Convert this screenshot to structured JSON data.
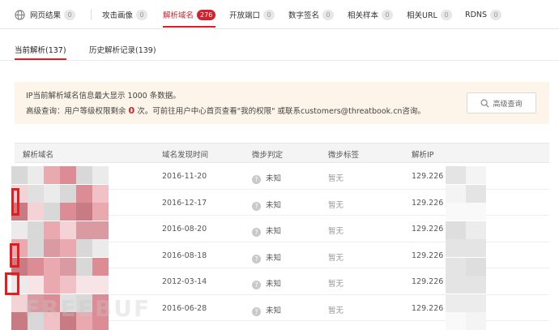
{
  "top_tabs": [
    {
      "label": "网页结果",
      "count": "0"
    },
    {
      "label": "攻击画像",
      "count": "0"
    },
    {
      "label": "解析域名",
      "count": "276"
    },
    {
      "label": "开放端口",
      "count": "0"
    },
    {
      "label": "数字签名",
      "count": "0"
    },
    {
      "label": "相关样本",
      "count": "0"
    },
    {
      "label": "相关URL",
      "count": "0"
    },
    {
      "label": "RDNS",
      "count": "0"
    }
  ],
  "sub_tabs": [
    {
      "label": "当前解析(137)"
    },
    {
      "label": "历史解析记录(139)"
    }
  ],
  "notice": {
    "line1": "IP当前解析域名信息最大显示 1000 条数据。",
    "line2_before": "高级查询：用户等级权限剩余",
    "line2_count": "0",
    "line2_after": "次。可前往用户中心首页查看\"我的权限\" 或联系customers@threatbook.cn咨询。",
    "button": "高级查询"
  },
  "table": {
    "headers": [
      "解析域名",
      "域名发现时间",
      "微步判定",
      "微步标签",
      "解析IP"
    ],
    "rows": [
      {
        "date": "2016-11-20",
        "verdict": "未知",
        "tag": "暂无",
        "ip": "129.226"
      },
      {
        "date": "2016-12-17",
        "verdict": "未知",
        "tag": "暂无",
        "ip": "129.226"
      },
      {
        "date": "2016-08-20",
        "verdict": "未知",
        "tag": "暂无",
        "ip": "129.226"
      },
      {
        "date": "2016-08-18",
        "verdict": "未知",
        "tag": "暂无",
        "ip": "129.226"
      },
      {
        "date": "2012-03-14",
        "verdict": "未知",
        "tag": "暂无",
        "ip": "129.226"
      },
      {
        "date": "2016-06-28",
        "verdict": "未知",
        "tag": "暂无",
        "ip": "129.226"
      }
    ]
  },
  "watermark": "FREEBUF",
  "colors": {
    "accent": "#d6202b",
    "notice_bg": "#fdf5ea",
    "header_bg": "#f4f4f4"
  }
}
